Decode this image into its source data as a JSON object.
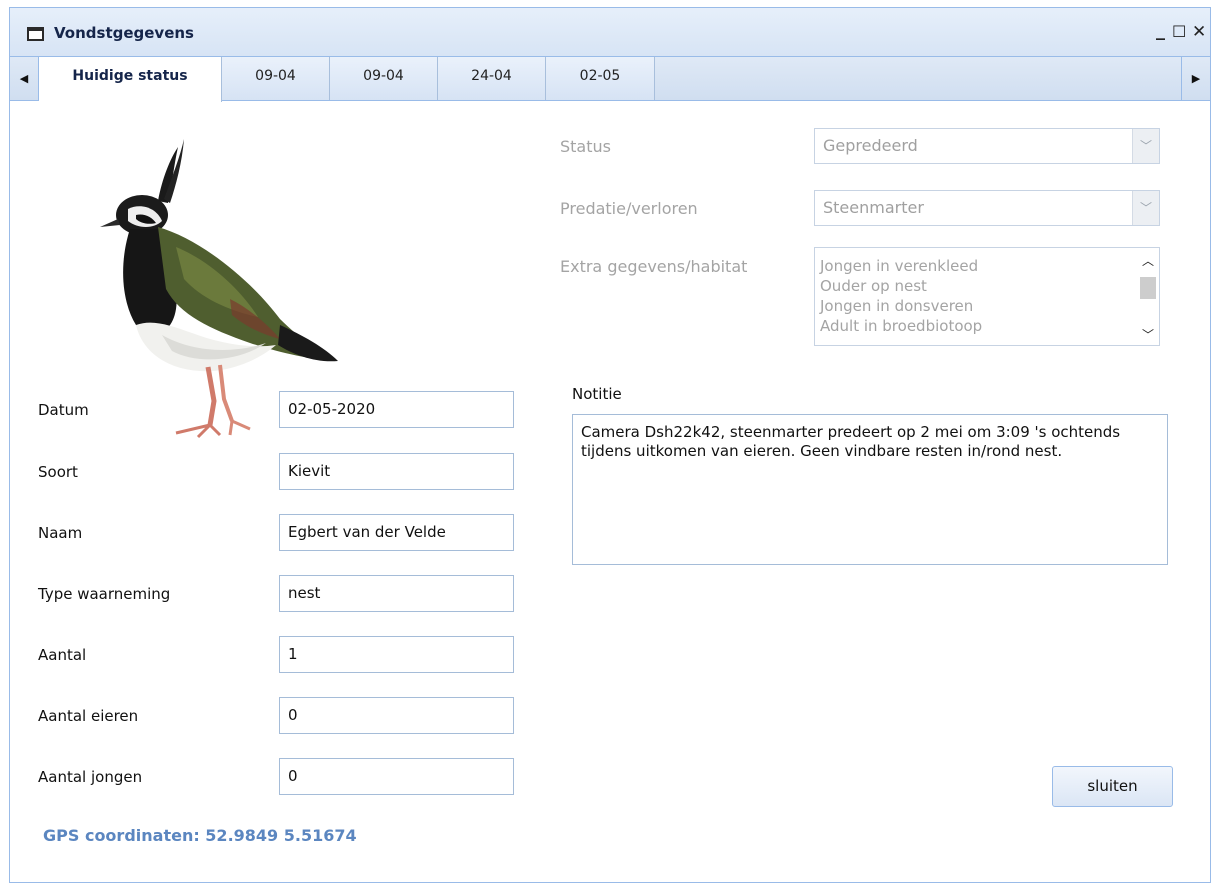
{
  "window": {
    "title": "Vondstgegevens",
    "controls": {
      "minimize": "_",
      "maximize": "☐",
      "close": "✕"
    }
  },
  "tabs": {
    "scroll_left": "◀",
    "scroll_right": "▶",
    "items": [
      {
        "label": "Huidige status",
        "active": true
      },
      {
        "label": "09-04",
        "active": false
      },
      {
        "label": "09-04",
        "active": false
      },
      {
        "label": "24-04",
        "active": false
      },
      {
        "label": "02-05",
        "active": false
      }
    ]
  },
  "fields": {
    "datum": {
      "label": "Datum",
      "value": "02-05-2020"
    },
    "soort": {
      "label": "Soort",
      "value": "Kievit"
    },
    "naam": {
      "label": "Naam",
      "value": "Egbert van der Velde"
    },
    "type": {
      "label": "Type waarneming",
      "value": "nest"
    },
    "aantal": {
      "label": "Aantal",
      "value": "1"
    },
    "eieren": {
      "label": "Aantal eieren",
      "value": "0"
    },
    "jongen": {
      "label": "Aantal jongen",
      "value": "0"
    }
  },
  "gps": "GPS coordinaten: 52.9849 5.51674",
  "right": {
    "status": {
      "label": "Status",
      "value": "Gepredeerd"
    },
    "predatie": {
      "label": "Predatie/verloren",
      "value": "Steenmarter"
    },
    "extra": {
      "label": "Extra gegevens/habitat",
      "options": [
        "Jongen in verenkleed",
        "Ouder op nest",
        "Jongen in donsveren",
        "Adult in broedbiotoop"
      ]
    },
    "notitie": {
      "label": "Notitie",
      "value": "Camera Dsh22k42, steenmarter predeert op 2 mei om 3:09 's ochtends tijdens uitkomen van eieren. Geen vindbare resten in/rond nest."
    }
  },
  "buttons": {
    "close": "sluiten"
  },
  "icons": [
    "window-icon",
    "bird-image",
    "dropdown-arrow-icon",
    "scroll-up-icon",
    "scroll-down-icon"
  ]
}
